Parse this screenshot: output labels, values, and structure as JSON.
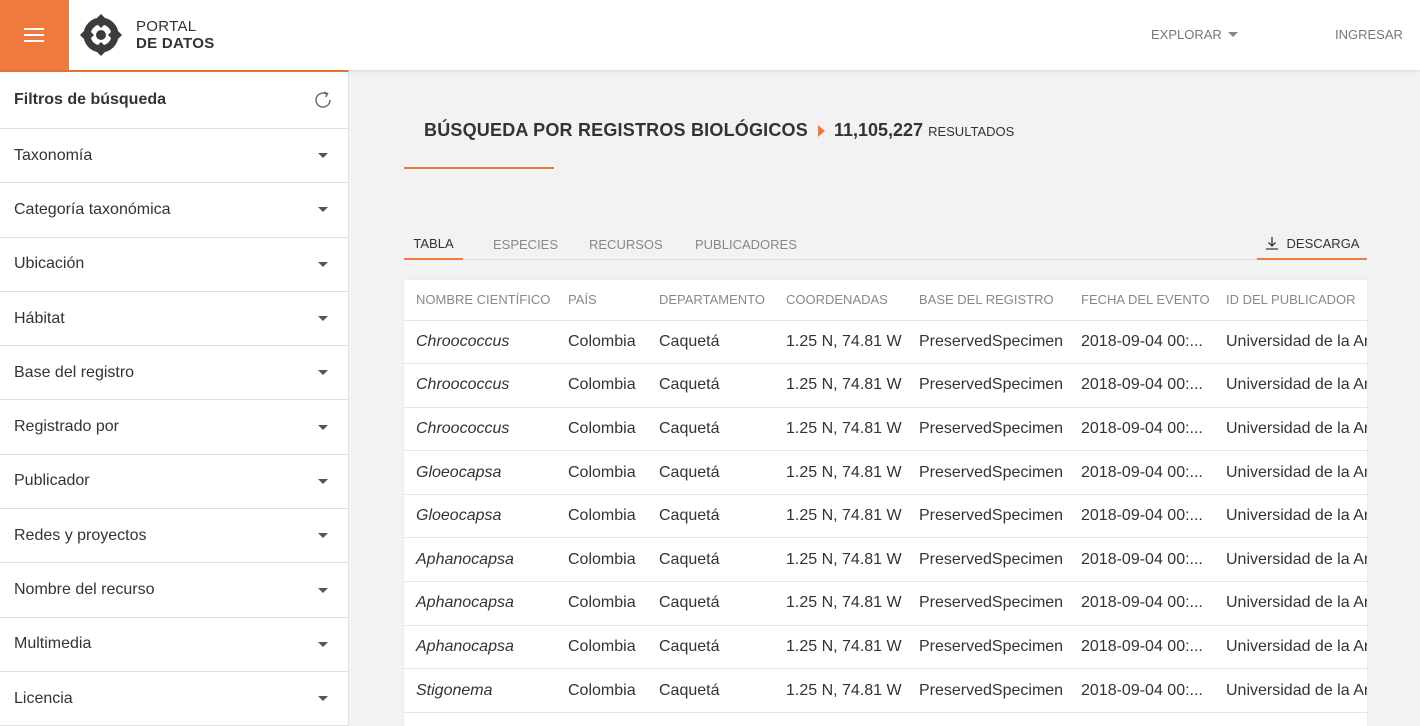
{
  "header": {
    "logo_line1": "PORTAL",
    "logo_line2": "DE DATOS",
    "nav_explore": "EXPLORAR",
    "nav_login": "INGRESAR"
  },
  "sidebar": {
    "title": "Filtros de búsqueda",
    "filters": [
      "Taxonomía",
      "Categoría taxonómica",
      "Ubicación",
      "Hábitat",
      "Base del registro",
      "Registrado por",
      "Publicador",
      "Redes y proyectos",
      "Nombre del recurso",
      "Multimedia",
      "Licencia"
    ]
  },
  "main": {
    "title": "BÚSQUEDA POR REGISTROS BIOLÓGICOS",
    "count": "11,105,227",
    "count_suffix": "RESULTADOS",
    "tabs": [
      "TABLA",
      "ESPECIES",
      "RECURSOS",
      "PUBLICADORES"
    ],
    "active_tab": "TABLA",
    "download_label": "DESCARGA"
  },
  "table": {
    "columns": [
      "NOMBRE CIENTÍFICO",
      "PAÍS",
      "DEPARTAMENTO",
      "COORDENADAS",
      "BASE DEL REGISTRO",
      "FECHA DEL EVENTO",
      "ID DEL PUBLICADOR"
    ],
    "rows": [
      [
        "Chroococcus",
        "Colombia",
        "Caquetá",
        "1.25 N, 74.81 W",
        "PreservedSpecimen",
        "2018-09-04 00:...",
        "Universidad de la An"
      ],
      [
        "Chroococcus",
        "Colombia",
        "Caquetá",
        "1.25 N, 74.81 W",
        "PreservedSpecimen",
        "2018-09-04 00:...",
        "Universidad de la An"
      ],
      [
        "Chroococcus",
        "Colombia",
        "Caquetá",
        "1.25 N, 74.81 W",
        "PreservedSpecimen",
        "2018-09-04 00:...",
        "Universidad de la An"
      ],
      [
        "Gloeocapsa",
        "Colombia",
        "Caquetá",
        "1.25 N, 74.81 W",
        "PreservedSpecimen",
        "2018-09-04 00:...",
        "Universidad de la An"
      ],
      [
        "Gloeocapsa",
        "Colombia",
        "Caquetá",
        "1.25 N, 74.81 W",
        "PreservedSpecimen",
        "2018-09-04 00:...",
        "Universidad de la An"
      ],
      [
        "Aphanocapsa",
        "Colombia",
        "Caquetá",
        "1.25 N, 74.81 W",
        "PreservedSpecimen",
        "2018-09-04 00:...",
        "Universidad de la An"
      ],
      [
        "Aphanocapsa",
        "Colombia",
        "Caquetá",
        "1.25 N, 74.81 W",
        "PreservedSpecimen",
        "2018-09-04 00:...",
        "Universidad de la An"
      ],
      [
        "Aphanocapsa",
        "Colombia",
        "Caquetá",
        "1.25 N, 74.81 W",
        "PreservedSpecimen",
        "2018-09-04 00:...",
        "Universidad de la An"
      ],
      [
        "Stigonema",
        "Colombia",
        "Caquetá",
        "1.25 N, 74.81 W",
        "PreservedSpecimen",
        "2018-09-04 00:...",
        "Universidad de la An"
      ]
    ]
  },
  "colors": {
    "accent": "#f0793d",
    "text": "#333333",
    "muted": "#888888",
    "background": "#f2f2f2"
  },
  "icons": [
    "menu-icon",
    "logo-icon",
    "caret-down-icon",
    "refresh-icon",
    "download-icon"
  ]
}
